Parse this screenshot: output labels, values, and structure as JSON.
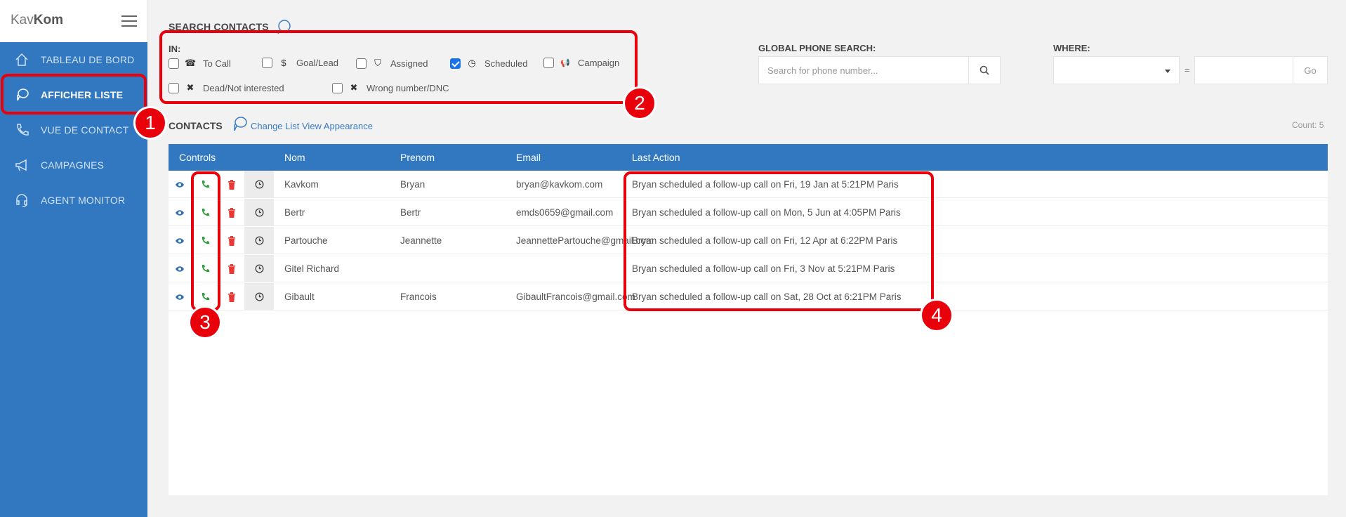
{
  "brand": {
    "prefix": "Kav",
    "bold": "Kom"
  },
  "sidebar": {
    "items": [
      {
        "label": "TABLEAU DE BORD",
        "icon": "home-icon"
      },
      {
        "label": "AFFICHER LISTE",
        "icon": "list-chat-icon",
        "active": true
      },
      {
        "label": "VUE DE CONTACT",
        "icon": "phone-icon"
      },
      {
        "label": "CAMPAGNES",
        "icon": "megaphone-icon"
      },
      {
        "label": "AGENT MONITOR",
        "icon": "headset-icon"
      }
    ]
  },
  "search": {
    "title": "SEARCH CONTACTS",
    "in_label": "IN:",
    "filters": [
      {
        "label": "To Call",
        "glyph": "☎",
        "checked": false
      },
      {
        "label": "Goal/Lead",
        "glyph": "$",
        "checked": false
      },
      {
        "label": "Assigned",
        "glyph": "⛉",
        "checked": false
      },
      {
        "label": "Scheduled",
        "glyph": "◷",
        "checked": true
      },
      {
        "label": "Campaign",
        "glyph": "📢",
        "checked": false
      },
      {
        "label": "Dead/Not interested",
        "glyph": "✖",
        "checked": false
      },
      {
        "label": "Wrong number/DNC",
        "glyph": "✖",
        "checked": false
      }
    ]
  },
  "global_search": {
    "label": "GLOBAL PHONE SEARCH:",
    "placeholder": "Search for phone number..."
  },
  "where": {
    "label": "WHERE:",
    "equals": "=",
    "go": "Go"
  },
  "contacts": {
    "title": "CONTACTS",
    "change_view": "Change List View Appearance",
    "count": "Count: 5",
    "columns": [
      "Controls",
      "Nom",
      "Prenom",
      "Email",
      "Last Action"
    ],
    "rows": [
      {
        "nom": "Kavkom",
        "prenom": "Bryan",
        "email": "bryan@kavkom.com",
        "last_action": "Bryan scheduled a follow-up call on Fri, 19 Jan at 5:21PM Paris"
      },
      {
        "nom": "Bertr",
        "prenom": "Bertr",
        "email": "emds0659@gmail.com",
        "last_action": "Bryan scheduled a follow-up call on Mon, 5 Jun at 4:05PM Paris"
      },
      {
        "nom": "Partouche",
        "prenom": "Jeannette",
        "email": "JeannettePartouche@gmail.com",
        "last_action": "Bryan scheduled a follow-up call on Fri, 12 Apr at 6:22PM Paris"
      },
      {
        "nom": "Gitel Richard",
        "prenom": "",
        "email": "",
        "last_action": "Bryan scheduled a follow-up call on Fri, 3 Nov at 5:21PM Paris"
      },
      {
        "nom": "Gibault",
        "prenom": "Francois",
        "email": "GibaultFrancois@gmail.com",
        "last_action": "Bryan scheduled a follow-up call on Sat, 28 Oct at 6:21PM Paris"
      }
    ]
  },
  "annotations": [
    "1",
    "2",
    "3",
    "4"
  ],
  "colors": {
    "sidebar": "#3178c0",
    "annotation": "#e8000b",
    "call": "#2e9e3e",
    "delete": "#e53935"
  }
}
